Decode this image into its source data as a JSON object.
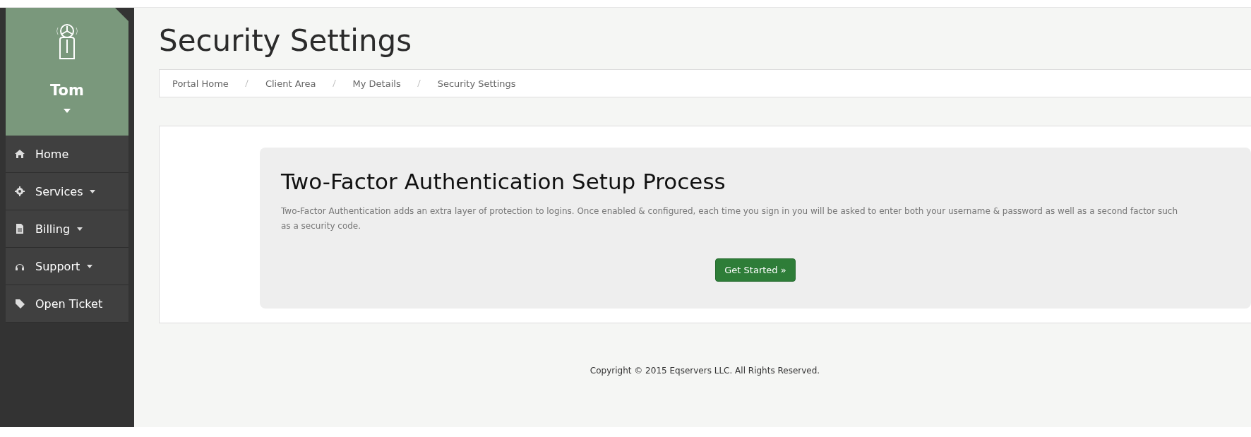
{
  "user": {
    "name": "Tom"
  },
  "sidebar": {
    "items": [
      {
        "label": "Home",
        "kind": "home",
        "has_dropdown": false
      },
      {
        "label": "Services",
        "kind": "services",
        "has_dropdown": true
      },
      {
        "label": "Billing",
        "kind": "billing",
        "has_dropdown": true
      },
      {
        "label": "Support",
        "kind": "support",
        "has_dropdown": true
      },
      {
        "label": "Open Ticket",
        "kind": "ticket",
        "has_dropdown": false
      }
    ]
  },
  "page_title": "Security Settings",
  "breadcrumb": [
    "Portal Home",
    "Client Area",
    "My Details",
    "Security Settings"
  ],
  "panel": {
    "heading": "Two-Factor Authentication Setup Process",
    "description": "Two-Factor Authentication adds an extra layer of protection to logins. Once enabled & configured, each time you sign in you will be asked to enter both your username & password as well as a second factor such as a security code.",
    "button": "Get Started »"
  },
  "footer": "Copyright © 2015 Eqservers LLC. All Rights Reserved."
}
